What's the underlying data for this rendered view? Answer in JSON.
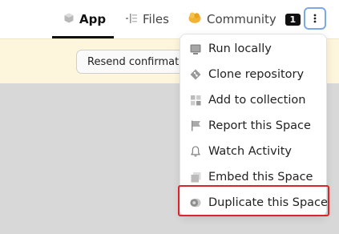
{
  "tabs": [
    {
      "label": "App",
      "icon": "cube-icon",
      "active": true
    },
    {
      "label": "Files",
      "icon": "files-icon",
      "active": false
    },
    {
      "label": "Community",
      "icon": "community-icon",
      "active": false,
      "badge": "1"
    }
  ],
  "more_button": {
    "icon": "vertical-dots-icon"
  },
  "banner": {
    "resend_label": "Resend confirmation email"
  },
  "menu": {
    "items": [
      {
        "label": "Run locally",
        "icon": "terminal-icon"
      },
      {
        "label": "Clone repository",
        "icon": "git-icon"
      },
      {
        "label": "Add to collection",
        "icon": "collection-icon"
      },
      {
        "label": "Report this Space",
        "icon": "flag-icon"
      },
      {
        "label": "Watch Activity",
        "icon": "bell-icon"
      },
      {
        "label": "Embed this Space",
        "icon": "embed-icon"
      },
      {
        "label": "Duplicate this Space",
        "icon": "duplicate-icon",
        "highlighted": true
      }
    ]
  },
  "colors": {
    "accent_border": "#7aa9e6",
    "highlight": "#d9262b",
    "banner_bg": "#fdf5dc"
  }
}
